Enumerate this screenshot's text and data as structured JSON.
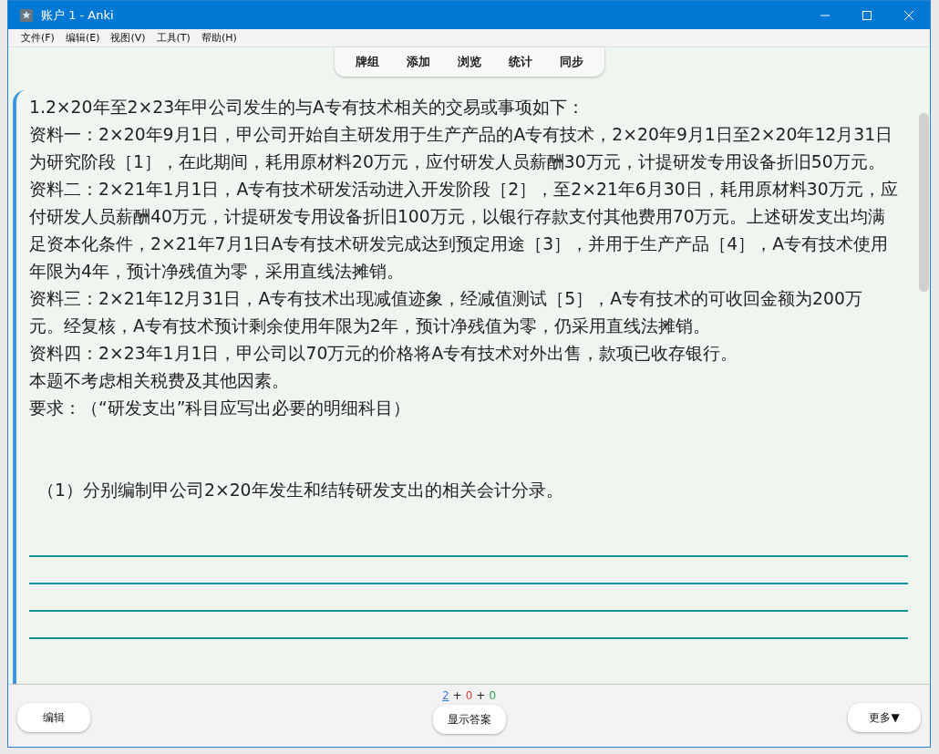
{
  "window": {
    "title": "账户 1 - Anki"
  },
  "menu": [
    "文件(F)",
    "编辑(E)",
    "视图(V)",
    "工具(T)",
    "帮助(H)"
  ],
  "toolbar": [
    "牌组",
    "添加",
    "浏览",
    "统计",
    "同步"
  ],
  "card": {
    "lines": [
      "1.2×20年至2×23年甲公司发生的与A专有技术相关的交易或事项如下：",
      "资料一：2×20年9月1日，甲公司开始自主研发用于生产产品的A专有技术，2×20年9月1日至2×20年12月31日",
      "为研究阶段［1］，在此期间，耗用原材料20万元，应付研发人员薪酬30万元，计提研发专用设备折旧50万元。",
      "资料二：2×21年1月1日，A专有技术研发活动进入开发阶段［2］，至2×21年6月30日，耗用原材料30万元，应",
      "付研发人员薪酬40万元，计提研发专用设备折旧100万元，以银行存款支付其他费用70万元。上述研发支出均满",
      "足资本化条件，2×21年7月1日A专有技术研发完成达到预定用途［3］，并用于生产产品［4］，A专有技术使用",
      "年限为4年，预计净残值为零，采用直线法摊销。",
      "资料三：2×21年12月31日，A专有技术出现减值迹象，经减值测试［5］，A专有技术的可收回金额为200万",
      "元。经复核，A专有技术预计剩余使用年限为2年，预计净残值为零，仍采用直线法摊销。",
      "资料四：2×23年1月1日，甲公司以70万元的价格将A专有技术对外出售，款项已收存银行。",
      "本题不考虑相关税费及其他因素。",
      "要求：（“研发支出”科目应写出必要的明细科目）"
    ],
    "question": "（1）分别编制甲公司2×20年发生和结转研发支出的相关会计分录。"
  },
  "counts": [
    {
      "text": "2",
      "color": "#3b7ddd",
      "kind": "link"
    },
    {
      "text": "+",
      "kind": "plain"
    },
    {
      "text": "0",
      "color": "#d9453a",
      "kind": "plain"
    },
    {
      "text": "+",
      "kind": "plain"
    },
    {
      "text": "0",
      "color": "#2e9a4e",
      "kind": "plain"
    }
  ],
  "buttons": {
    "edit": "编辑",
    "show_answer": "显示答案",
    "more": "更多▼"
  }
}
